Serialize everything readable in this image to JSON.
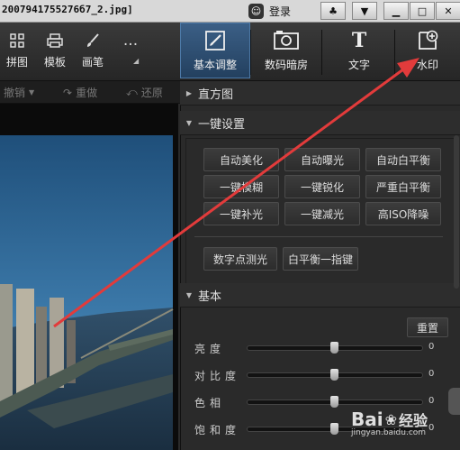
{
  "titlebar": {
    "filename": "2007941755276б7_2.jpg]",
    "login_label": "登录",
    "login_icon": "smile-face-icon",
    "buttons": [
      "skin-icon",
      "menu-icon",
      "minimize-icon",
      "maximize-icon",
      "close-icon"
    ]
  },
  "toolbar": {
    "tools": [
      {
        "label": "拼图",
        "icon": "grid-icon"
      },
      {
        "label": "模板",
        "icon": "printer-icon"
      },
      {
        "label": "画笔",
        "icon": "brush-icon"
      },
      {
        "label": "",
        "icon": "more-icon"
      }
    ],
    "tabs": [
      {
        "label": "基本调整",
        "icon": "adjust-icon",
        "active": true
      },
      {
        "label": "数码暗房",
        "icon": "camera-icon",
        "active": false
      },
      {
        "label": "文字",
        "icon": "text-icon",
        "active": false
      },
      {
        "label": "水印",
        "icon": "watermark-add-icon",
        "active": false
      }
    ]
  },
  "undo_bar": {
    "undo": "撤销",
    "redo": "重做",
    "restore": "还原"
  },
  "panel": {
    "histogram_title": "直方图",
    "oneclick_title": "一键设置",
    "oneclick_buttons": [
      "自动美化",
      "自动曝光",
      "自动白平衡",
      "一键模糊",
      "一键锐化",
      "严重白平衡",
      "一键补光",
      "一键减光",
      "高ISO降噪"
    ],
    "extra_buttons": [
      "数字点测光",
      "白平衡一指键"
    ],
    "basic_title": "基本",
    "reset_label": "重置",
    "sliders": [
      {
        "label": "亮度",
        "value": 0
      },
      {
        "label": "对比度",
        "value": 0
      },
      {
        "label": "色相",
        "value": 0
      },
      {
        "label": "饱和度",
        "value": 0
      }
    ]
  },
  "watermark": {
    "brand": "Bai",
    "brand_cn": "经验",
    "url": "jingyan.baidu.com"
  },
  "colors": {
    "accent": "#3b5f86",
    "arrow": "#e23b3b",
    "panel_bg": "#2a2a2a"
  }
}
